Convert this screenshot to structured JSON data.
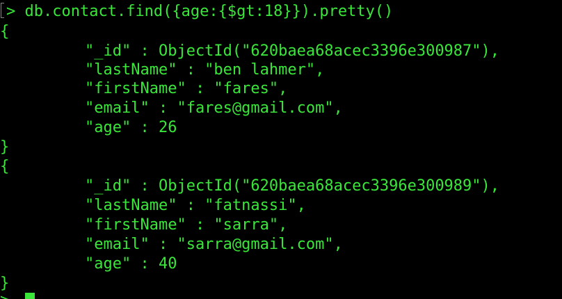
{
  "terminal": {
    "command": {
      "prompt": "> ",
      "text": "db.contact.find({age:{$gt:18}}).pretty()"
    },
    "documents": [
      {
        "open": "{",
        "lines": [
          "\"_id\" : ObjectId(\"620baea68acec3396e300987\"),",
          "\"lastName\" : \"ben lahmer\",",
          "\"firstName\" : \"fares\",",
          "\"email\" : \"fares@gmail.com\",",
          "\"age\" : 26"
        ],
        "close": "}"
      },
      {
        "open": "{",
        "lines": [
          "\"_id\" : ObjectId(\"620baea68acec3396e300989\"),",
          "\"lastName\" : \"fatnassi\",",
          "\"firstName\" : \"sarra\",",
          "\"email\" : \"sarra@gmail.com\",",
          "\"age\" : 40"
        ],
        "close": "}"
      }
    ],
    "next_prompt": "> ",
    "colors": {
      "background": "#000000",
      "text": "#39e639",
      "cursor": "#39e639"
    }
  }
}
